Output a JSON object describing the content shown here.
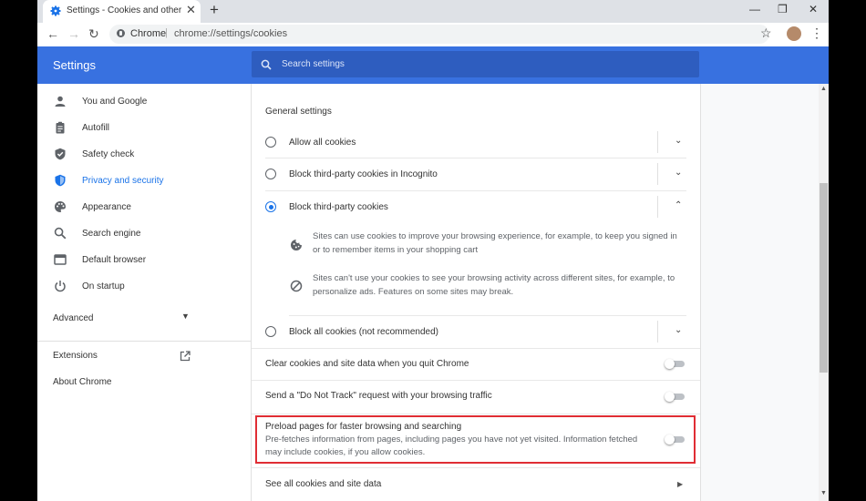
{
  "tab": {
    "title": "Settings - Cookies and other site data",
    "close": "✕",
    "new_tab": "+"
  },
  "window": {
    "minimize": "—",
    "restore": "❐",
    "close": "✕"
  },
  "toolbar": {
    "back": "←",
    "forward": "→",
    "reload": "↻",
    "site_label": "Chrome",
    "separator": "|",
    "url": "chrome://settings/cookies",
    "star": "☆",
    "menu": "⋮"
  },
  "header": {
    "title": "Settings",
    "search_placeholder": "Search settings"
  },
  "sidebar": {
    "items": [
      {
        "label": "You and Google",
        "icon": "person-icon"
      },
      {
        "label": "Autofill",
        "icon": "clipboard-icon"
      },
      {
        "label": "Safety check",
        "icon": "shield-check-icon"
      },
      {
        "label": "Privacy and security",
        "icon": "shield-icon",
        "active": true
      },
      {
        "label": "Appearance",
        "icon": "palette-icon"
      },
      {
        "label": "Search engine",
        "icon": "search-icon"
      },
      {
        "label": "Default browser",
        "icon": "browser-window-icon"
      },
      {
        "label": "On startup",
        "icon": "power-icon"
      }
    ],
    "advanced": {
      "label": "Advanced",
      "caret": "▼"
    },
    "extensions": "Extensions",
    "about": "About Chrome"
  },
  "main": {
    "general_settings": "General settings",
    "options": [
      {
        "label": "Allow all cookies",
        "selected": false,
        "chevron": "⌄"
      },
      {
        "label": "Block third-party cookies in Incognito",
        "selected": false,
        "chevron": "⌄"
      },
      {
        "label": "Block third-party cookies",
        "selected": true,
        "chevron": "⌃"
      },
      {
        "label": "Block all cookies (not recommended)",
        "selected": false,
        "chevron": "⌄"
      }
    ],
    "details": [
      {
        "icon": "cookie-icon",
        "text": "Sites can use cookies to improve your browsing experience, for example, to keep you signed in or to remember items in your shopping cart"
      },
      {
        "icon": "block-icon",
        "text": "Sites can't use your cookies to see your browsing activity across different sites, for example, to personalize ads. Features on some sites may break."
      }
    ],
    "toggles": [
      {
        "label": "Clear cookies and site data when you quit Chrome",
        "on": false
      },
      {
        "label": "Send a \"Do Not Track\" request with your browsing traffic",
        "on": false
      },
      {
        "label": "Preload pages for faster browsing and searching",
        "description": "Pre-fetches information from pages, including pages you have not yet visited. Information fetched may include cookies, if you allow cookies.",
        "on": false
      }
    ],
    "see_all": {
      "label": "See all cookies and site data",
      "arrow": "▶"
    }
  },
  "scrollbar": {
    "up": "▲",
    "down": "▼"
  },
  "colors": {
    "accent": "#1a73e8",
    "header": "#3871e0",
    "highlight": "#e02d34"
  }
}
